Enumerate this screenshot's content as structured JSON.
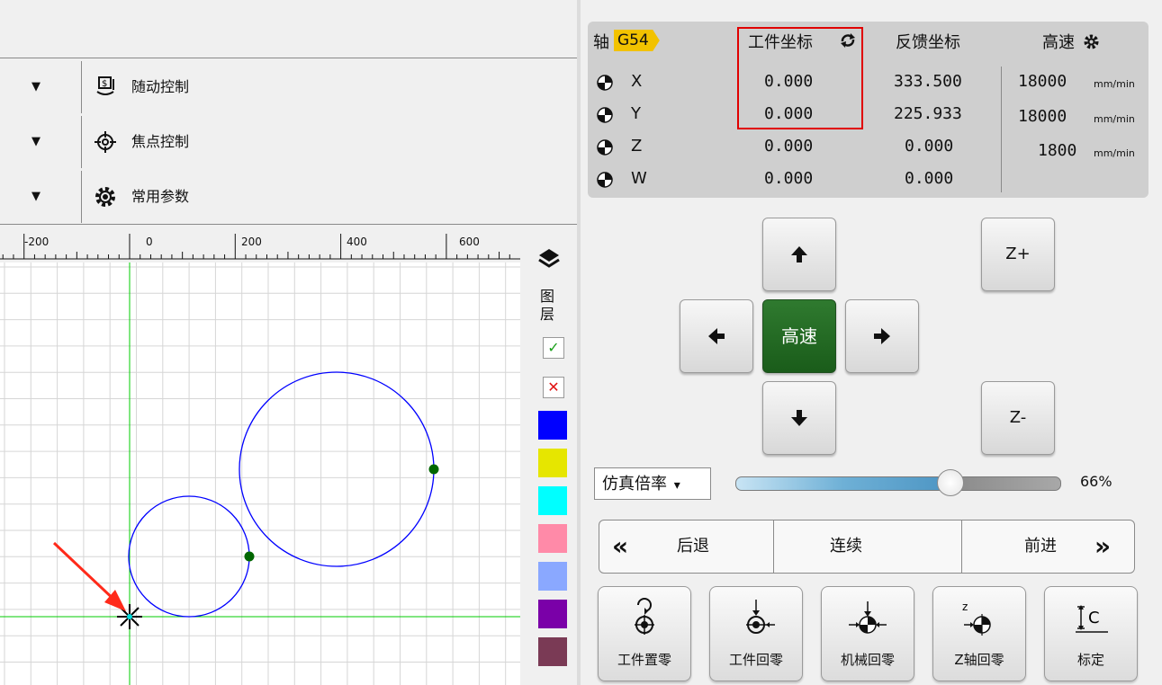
{
  "left_controls": [
    {
      "label": "随动控制",
      "icon": "follow-control-icon",
      "arrow": "▼"
    },
    {
      "label": "焦点控制",
      "icon": "focus-target-icon",
      "arrow": "▼"
    },
    {
      "label": "常用参数",
      "icon": "gear-icon",
      "arrow": "▼"
    }
  ],
  "ruler": {
    "ticks": [
      "-200",
      "0",
      "200",
      "400",
      "600"
    ]
  },
  "layers": {
    "title_line1": "图",
    "title_line2": "层",
    "check_symbol": "✓",
    "cross_symbol": "✕",
    "colors": [
      "#0000ff",
      "#e6e600",
      "#00ffff",
      "#ff8aa8",
      "#8aa8ff",
      "#7a00a8",
      "#7a3a55"
    ]
  },
  "coords": {
    "axis_label": "轴",
    "coord_system": "G54",
    "work_header": "工件坐标",
    "feedback_header": "反馈坐标",
    "speed_header": "高速",
    "rows": [
      {
        "axis": "X",
        "work": "0.000",
        "feedback": "333.500",
        "speed": "18000",
        "unit": "mm/min"
      },
      {
        "axis": "Y",
        "work": "0.000",
        "feedback": "225.933",
        "speed": "18000",
        "unit": "mm/min"
      },
      {
        "axis": "Z",
        "work": "0.000",
        "feedback": "0.000",
        "speed": "1800",
        "unit": "mm/min"
      },
      {
        "axis": "W",
        "work": "0.000",
        "feedback": "0.000",
        "speed": "",
        "unit": ""
      }
    ],
    "highlight_color": "#e00000"
  },
  "jog": {
    "center_label": "高速",
    "z_plus": "Z+",
    "z_minus": "Z-"
  },
  "sim_rate": {
    "label": "仿真倍率",
    "arrow": "▾",
    "value": "66%",
    "level": 0.66
  },
  "step": {
    "back_icon": "«",
    "back_label": "后退",
    "continuous_label": "连续",
    "forward_label": "前进",
    "forward_icon": "»"
  },
  "bottom_buttons": [
    {
      "label": "工件置零",
      "icon": "workpiece-zero-icon"
    },
    {
      "label": "工件回零",
      "icon": "workpiece-return-icon"
    },
    {
      "label": "机械回零",
      "icon": "machine-return-icon"
    },
    {
      "label": "Z轴回零",
      "icon": "z-axis-return-icon",
      "icon_letter": "z"
    },
    {
      "label": "标定",
      "icon": "calibrate-icon",
      "icon_letter": "C"
    }
  ],
  "colors": {
    "jog_active": "#1f6b1f",
    "g54_badge": "#f2c200",
    "canvas_path": "#0000ff",
    "origin_axis": "#00cc00",
    "annotation_arrow": "#ff2a1a"
  }
}
